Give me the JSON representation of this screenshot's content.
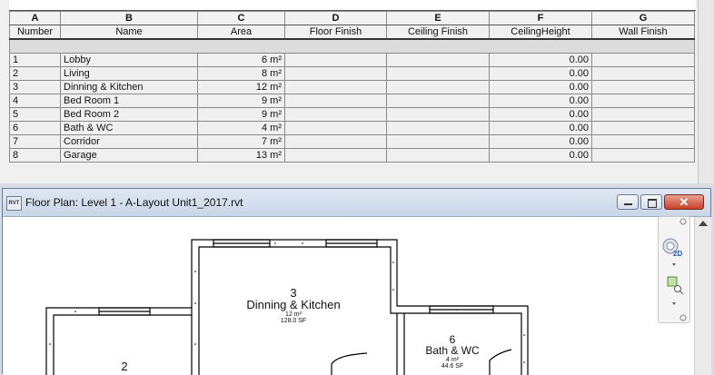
{
  "schedule": {
    "column_letters": [
      "A",
      "B",
      "C",
      "D",
      "E",
      "F",
      "G"
    ],
    "headers": [
      "Number",
      "Name",
      "Area",
      "Floor Finish",
      "Ceiling Finish",
      "CeilingHeight",
      "Wall Finish"
    ],
    "rows": [
      {
        "number": "1",
        "name": "Lobby",
        "area": "6 m²",
        "floor": "",
        "ceiling": "",
        "height": "0.00",
        "wall": ""
      },
      {
        "number": "2",
        "name": "Living",
        "area": "8 m²",
        "floor": "",
        "ceiling": "",
        "height": "0.00",
        "wall": ""
      },
      {
        "number": "3",
        "name": "Dinning & Kitchen",
        "area": "12 m²",
        "floor": "",
        "ceiling": "",
        "height": "0.00",
        "wall": ""
      },
      {
        "number": "4",
        "name": "Bed Room 1",
        "area": "9 m²",
        "floor": "",
        "ceiling": "",
        "height": "0.00",
        "wall": ""
      },
      {
        "number": "5",
        "name": "Bed Room 2",
        "area": "9 m²",
        "floor": "",
        "ceiling": "",
        "height": "0.00",
        "wall": ""
      },
      {
        "number": "6",
        "name": "Bath & WC",
        "area": "4 m²",
        "floor": "",
        "ceiling": "",
        "height": "0.00",
        "wall": ""
      },
      {
        "number": "7",
        "name": "Corridor",
        "area": "7 m²",
        "floor": "",
        "ceiling": "",
        "height": "0.00",
        "wall": ""
      },
      {
        "number": "8",
        "name": "Garage",
        "area": "13 m²",
        "floor": "",
        "ceiling": "",
        "height": "0.00",
        "wall": ""
      }
    ]
  },
  "floor_plan_window": {
    "icon_text": "RVT",
    "title": "Floor Plan: Level 1 - A-Layout Unit1_2017.rvt",
    "close_glyph": "✕",
    "nav_2d": "2D",
    "rooms": {
      "dinning": {
        "number": "3",
        "name": "Dinning & Kitchen",
        "area_m2": "12 m²",
        "area_sf": "128.0 SF"
      },
      "bath": {
        "number": "6",
        "name": "Bath & WC",
        "area_m2": "4 m²",
        "area_sf": "44.6 SF"
      },
      "living": {
        "number": "2"
      }
    }
  }
}
